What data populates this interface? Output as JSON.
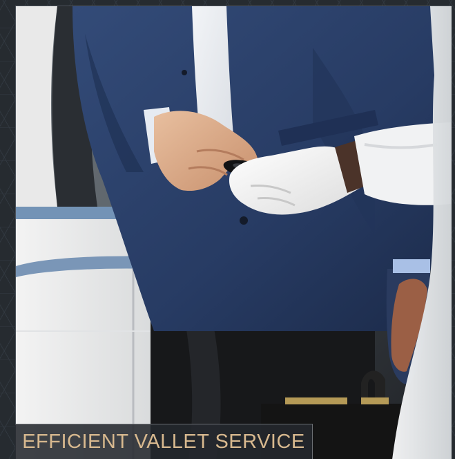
{
  "caption": {
    "text": "EFFICIENT VALLET SERVICE",
    "color": "#d8b98f"
  },
  "photo": {
    "subject": "valet-key-handover"
  },
  "colors": {
    "background": "#262b30",
    "jacket": "#273b63",
    "glove": "#f1f1ef",
    "caption_panel": "#24282d"
  }
}
